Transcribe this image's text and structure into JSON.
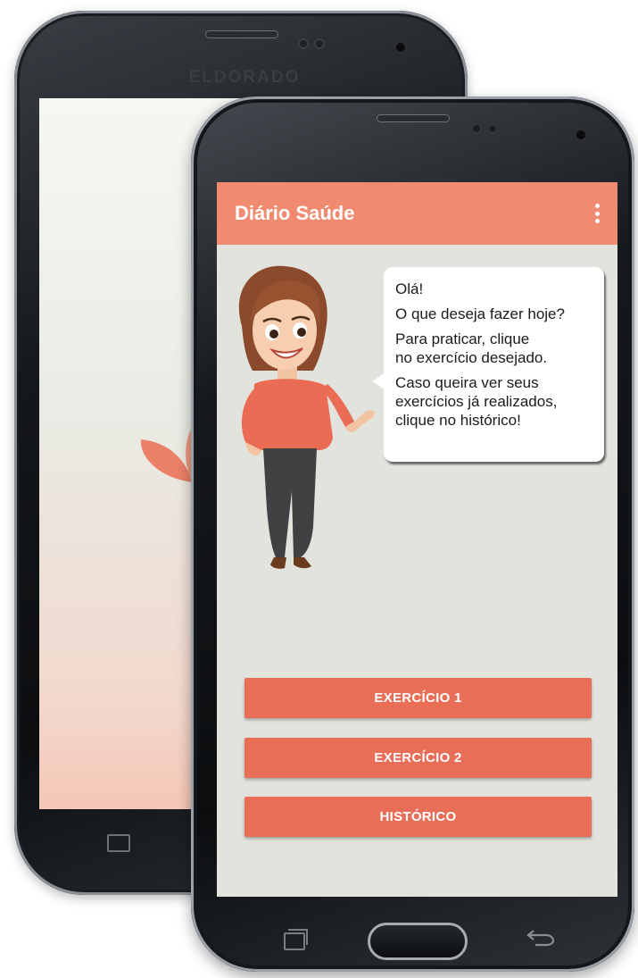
{
  "back_phone": {
    "brand": "ELDORADO"
  },
  "app": {
    "title": "Diário Saúde",
    "menu_icon": "overflow-menu-icon",
    "accent_color": "#f08b72",
    "button_color": "#e86e58",
    "background_color": "#e2e3dd"
  },
  "speech": {
    "greeting": "Olá!",
    "question": "O que deseja fazer hoje?",
    "instruction": "Para praticar,  clique\nno exercício desejado.",
    "history_hint": "Caso queira ver seus\nexercícios já realizados,\nclique no histórico!"
  },
  "buttons": {
    "exercise1": "EXERCÍCIO 1",
    "exercise2": "EXERCÍCIO 2",
    "history": "HISTÓRICO"
  },
  "nav": {
    "recent_icon": "recent-apps-icon",
    "home_icon": "home-button",
    "back_icon": "back-arrow-icon"
  }
}
